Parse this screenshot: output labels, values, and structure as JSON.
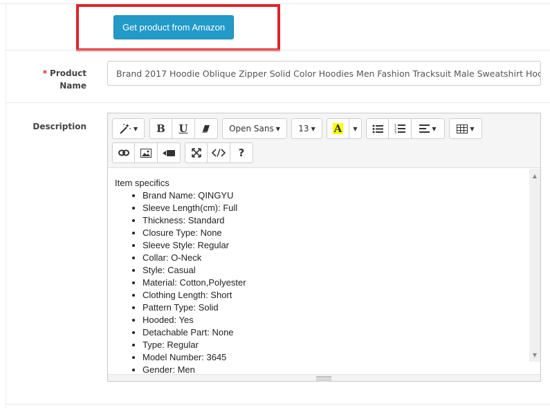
{
  "amazon_button": {
    "label": "Get product from Amazon",
    "color": "#229ac8"
  },
  "highlight_color": "#e2222a",
  "product_name": {
    "required_marker": "*",
    "label_line1": "Product",
    "label_line2": "Name",
    "value": "Brand 2017 Hoodie Oblique Zipper Solid Color Hoodies Men Fashion Tracksuit Male Sweatshirt Hoc"
  },
  "description": {
    "label": "Description",
    "toolbar": {
      "font_family": "Open Sans",
      "font_size": "13",
      "color_button_letter": "A",
      "icons": [
        "magic-wand-icon",
        "bold-icon",
        "underline-icon",
        "eraser-icon",
        "font-family-dropdown",
        "font-size-dropdown",
        "text-color-icon",
        "unordered-list-icon",
        "ordered-list-icon",
        "align-icon",
        "table-icon",
        "link-icon",
        "picture-icon",
        "video-icon",
        "fullscreen-icon",
        "code-view-icon",
        "help-icon"
      ]
    },
    "content": {
      "heading": "Item specifics",
      "items": [
        "Brand Name: QINGYU",
        "Sleeve Length(cm): Full",
        "Thickness: Standard",
        "Closure Type: None",
        "Sleeve Style: Regular",
        "Collar: O-Neck",
        "Style: Casual",
        "Material: Cotton,Polyester",
        "Clothing Length: Short",
        "Pattern Type: Solid",
        "Hooded: Yes",
        "Detachable Part: None",
        "Type: Regular",
        "Model Number: 3645",
        "Gender: Men"
      ]
    }
  }
}
